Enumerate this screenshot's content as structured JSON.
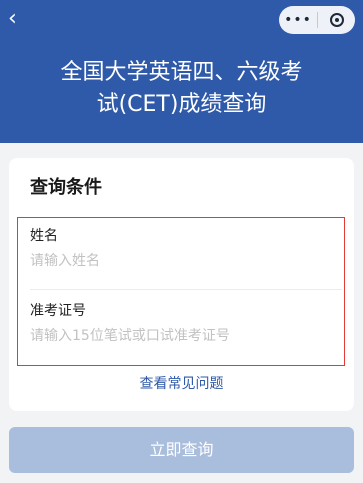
{
  "colors": {
    "header_bg": "#2f5aa9",
    "highlight_border": "#e53935",
    "link": "#2f5aa9",
    "button_disabled_bg": "#a9bddd"
  },
  "nav": {
    "back_icon": "chevron-left-icon",
    "more_icon": "more-dots-icon",
    "close_icon": "target-circle-icon"
  },
  "header": {
    "title_line1": "全国大学英语四、六级考",
    "title_line2": "试(CET)成绩查询"
  },
  "card": {
    "title": "查询条件",
    "fields": [
      {
        "label": "姓名",
        "value": "",
        "placeholder": "请输入姓名"
      },
      {
        "label": "准考证号",
        "value": "",
        "placeholder": "请输入15位笔试或口试准考证号"
      }
    ],
    "faq_link": "查看常见问题"
  },
  "actions": {
    "submit_label": "立即查询"
  }
}
